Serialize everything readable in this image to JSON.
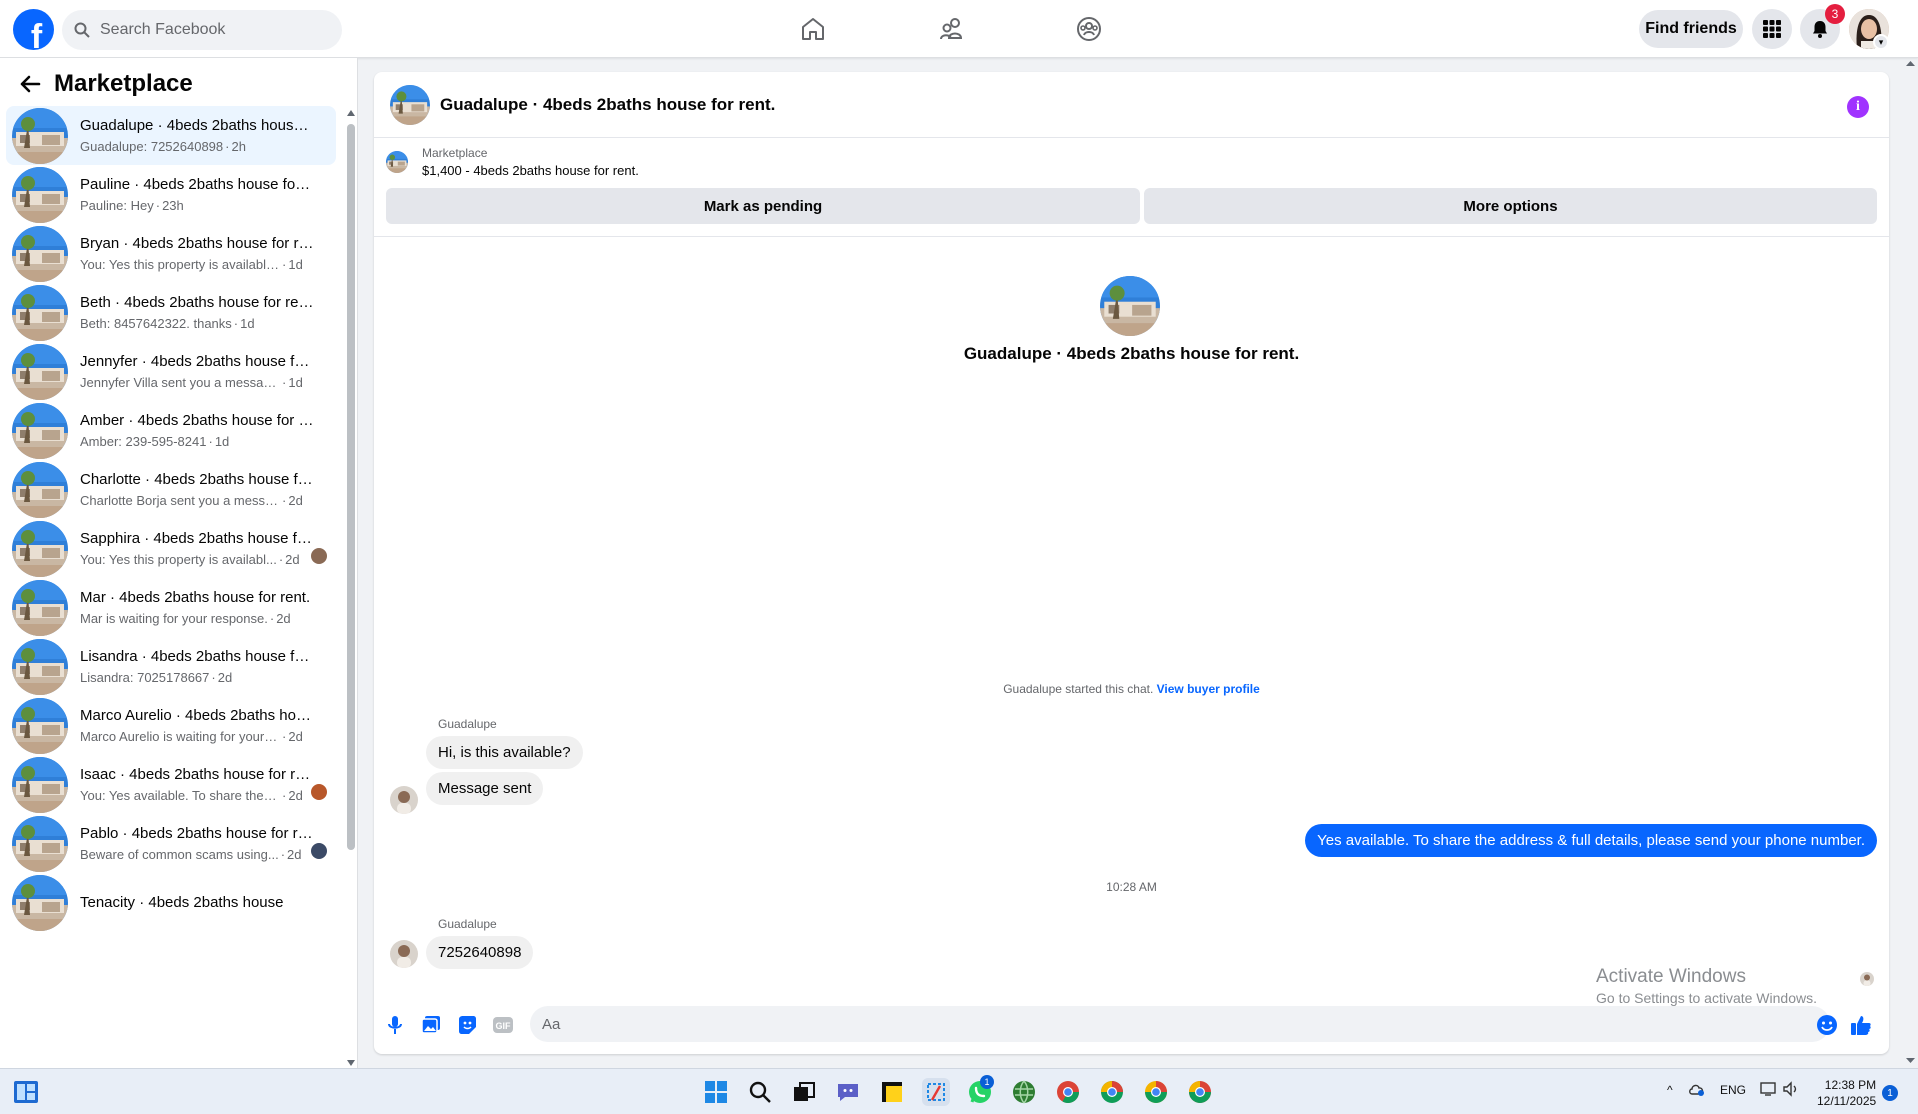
{
  "topbar": {
    "logo": "f",
    "search_placeholder": "Search Facebook",
    "find_friends": "Find friends",
    "notifications_count": "3"
  },
  "sidebar": {
    "title": "Marketplace",
    "conversations": [
      {
        "name": "Guadalupe · 4beds 2baths house for rent.",
        "snippet": "Guadalupe: 7252640898",
        "time": "2h",
        "active": true
      },
      {
        "name": "Pauline · 4beds 2baths house for rent.",
        "snippet": "Pauline: Hey",
        "time": "23h"
      },
      {
        "name": "Bryan · 4beds 2baths house for rent.",
        "snippet": "You: Yes this property is available. F...",
        "time": "1d"
      },
      {
        "name": "Beth · 4beds 2baths house for rent.",
        "snippet": "Beth: 8457642322. thanks",
        "time": "1d"
      },
      {
        "name": "Jennyfer · 4beds 2baths house for rent.",
        "snippet": "Jennyfer Villa sent you a message a...",
        "time": "1d"
      },
      {
        "name": "Amber · 4beds 2baths house for rent.",
        "snippet": "Amber: 239-595-8241",
        "time": "1d"
      },
      {
        "name": "Charlotte · 4beds 2baths house for rent.",
        "snippet": "Charlotte Borja sent you a message...",
        "time": "2d"
      },
      {
        "name": "Sapphira · 4beds 2baths house for rent.",
        "snippet": "You: Yes this property is availabl...",
        "time": "2d"
      },
      {
        "name": "Mar · 4beds 2baths house for rent.",
        "snippet": "Mar is waiting for your response.",
        "time": "2d"
      },
      {
        "name": "Lisandra · 4beds 2baths house for rent.",
        "snippet": "Lisandra: 7025178667",
        "time": "2d"
      },
      {
        "name": "Marco Aurelio · 4beds 2baths house for rent.",
        "snippet": "Marco Aurelio is waiting for your r...",
        "time": "2d"
      },
      {
        "name": "Isaac · 4beds 2baths house for rent.",
        "snippet": "You: Yes available. To share the a...",
        "time": "2d"
      },
      {
        "name": "Pablo · 4beds 2baths house for rent.",
        "snippet": "Beware of common scams using...",
        "time": "2d"
      },
      {
        "name": "Tenacity · 4beds 2baths house",
        "snippet": "",
        "time": ""
      }
    ]
  },
  "chat": {
    "title": "Guadalupe · 4beds 2baths house for rent.",
    "listing_label": "Marketplace",
    "listing_price": "$1,400 - 4beds 2baths house for rent.",
    "mark_pending": "Mark as pending",
    "more_options": "More options",
    "center_title": "Guadalupe · 4beds 2baths house for rent.",
    "started_text": "Guadalupe started this chat.",
    "view_profile": "View buyer profile",
    "sender1": "Guadalupe",
    "msg1": "Hi, is this available?",
    "msg2": "Message sent",
    "msg_out": "Yes available. To share the address & full details, please send your phone number.",
    "timestamp": "10:28 AM",
    "sender2": "Guadalupe",
    "msg3": "7252640898",
    "composer_placeholder": "Aa"
  },
  "watermark": {
    "line1": "Activate Windows",
    "line2": "Go to Settings to activate Windows."
  },
  "taskbar": {
    "lang": "ENG",
    "time": "12:38 PM",
    "date": "12/11/2025",
    "whatsapp_badge": "1",
    "notif_badge": "1"
  },
  "colors": {
    "brand": "#0866ff",
    "info": "#a033ff",
    "badge": "#e41e3f"
  }
}
